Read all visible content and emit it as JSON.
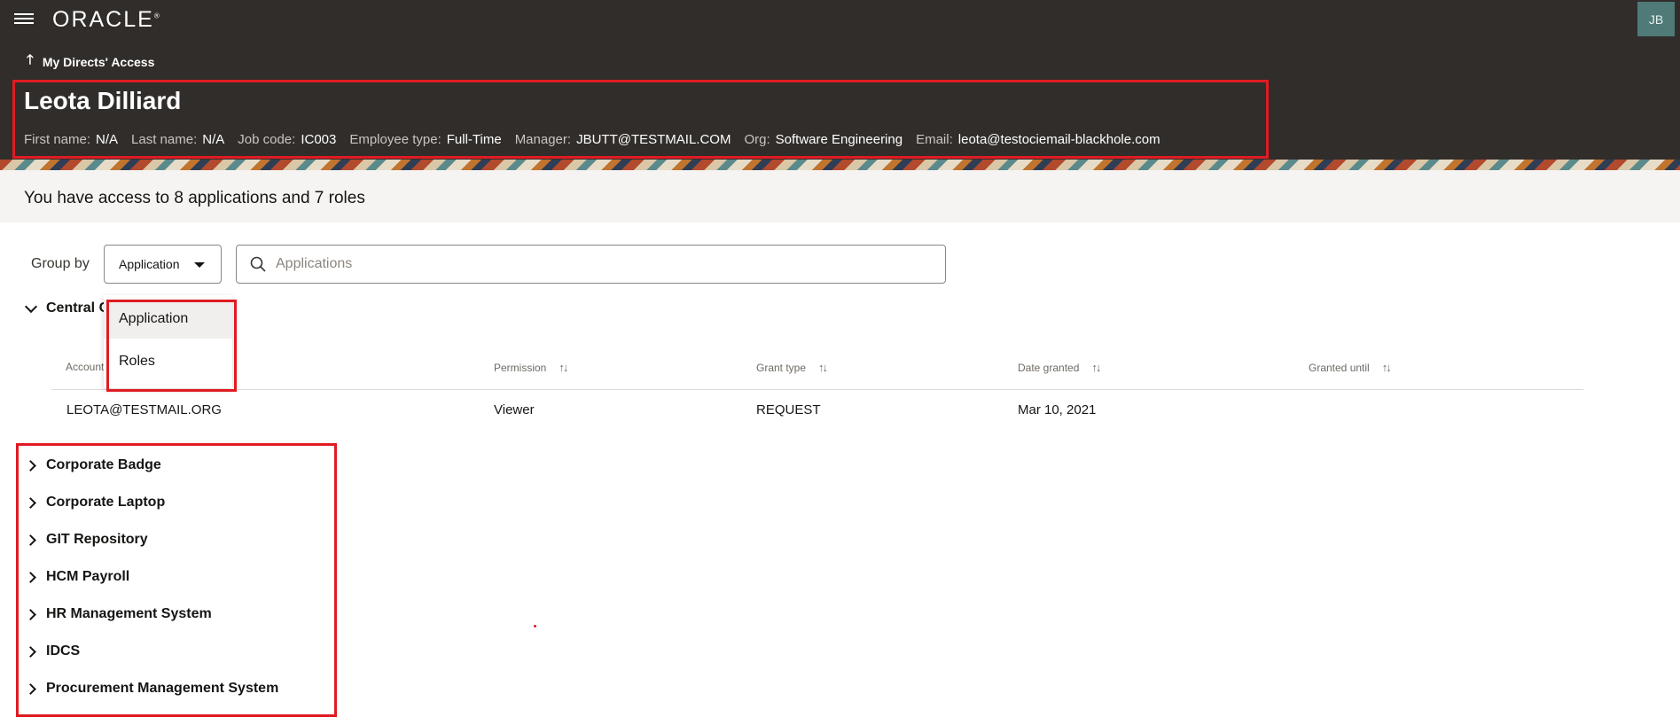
{
  "header": {
    "logo_text": "ORACLE",
    "avatar_initials": "JB",
    "back_link": "My Directs' Access"
  },
  "person": {
    "name": "Leota Dilliard",
    "fields": [
      {
        "label": "First name:",
        "value": "N/A"
      },
      {
        "label": "Last name:",
        "value": "N/A"
      },
      {
        "label": "Job code:",
        "value": "IC003"
      },
      {
        "label": "Employee type:",
        "value": "Full-Time"
      },
      {
        "label": "Manager:",
        "value": "JBUTT@TESTMAIL.COM"
      },
      {
        "label": "Org:",
        "value": "Software Engineering"
      },
      {
        "label": "Email:",
        "value": "leota@testociemail-blackhole.com"
      }
    ]
  },
  "summary": {
    "text": "You have access to 8 applications and 7 roles"
  },
  "controls": {
    "group_by_label": "Group by",
    "group_by_value": "Application",
    "search_placeholder": "Applications",
    "dropdown_options": [
      "Application",
      "Roles"
    ]
  },
  "expanded_group": {
    "name": "Central C",
    "columns": [
      "Account",
      "Permission",
      "Grant type",
      "Date granted",
      "Granted until"
    ],
    "rows": [
      {
        "account": "LEOTA@TESTMAIL.ORG",
        "permission": "Viewer",
        "grant_type": "REQUEST",
        "date_granted": "Mar 10, 2021",
        "granted_until": ""
      }
    ]
  },
  "collapsed_groups": [
    "Corporate Badge",
    "Corporate Laptop",
    "GIT Repository",
    "HCM Payroll",
    "HR Management System",
    "IDCS",
    "Procurement Management System"
  ],
  "colors": {
    "header_bg": "#312d2a",
    "highlight": "#e01b22",
    "summary_bg": "#f5f4f2"
  }
}
